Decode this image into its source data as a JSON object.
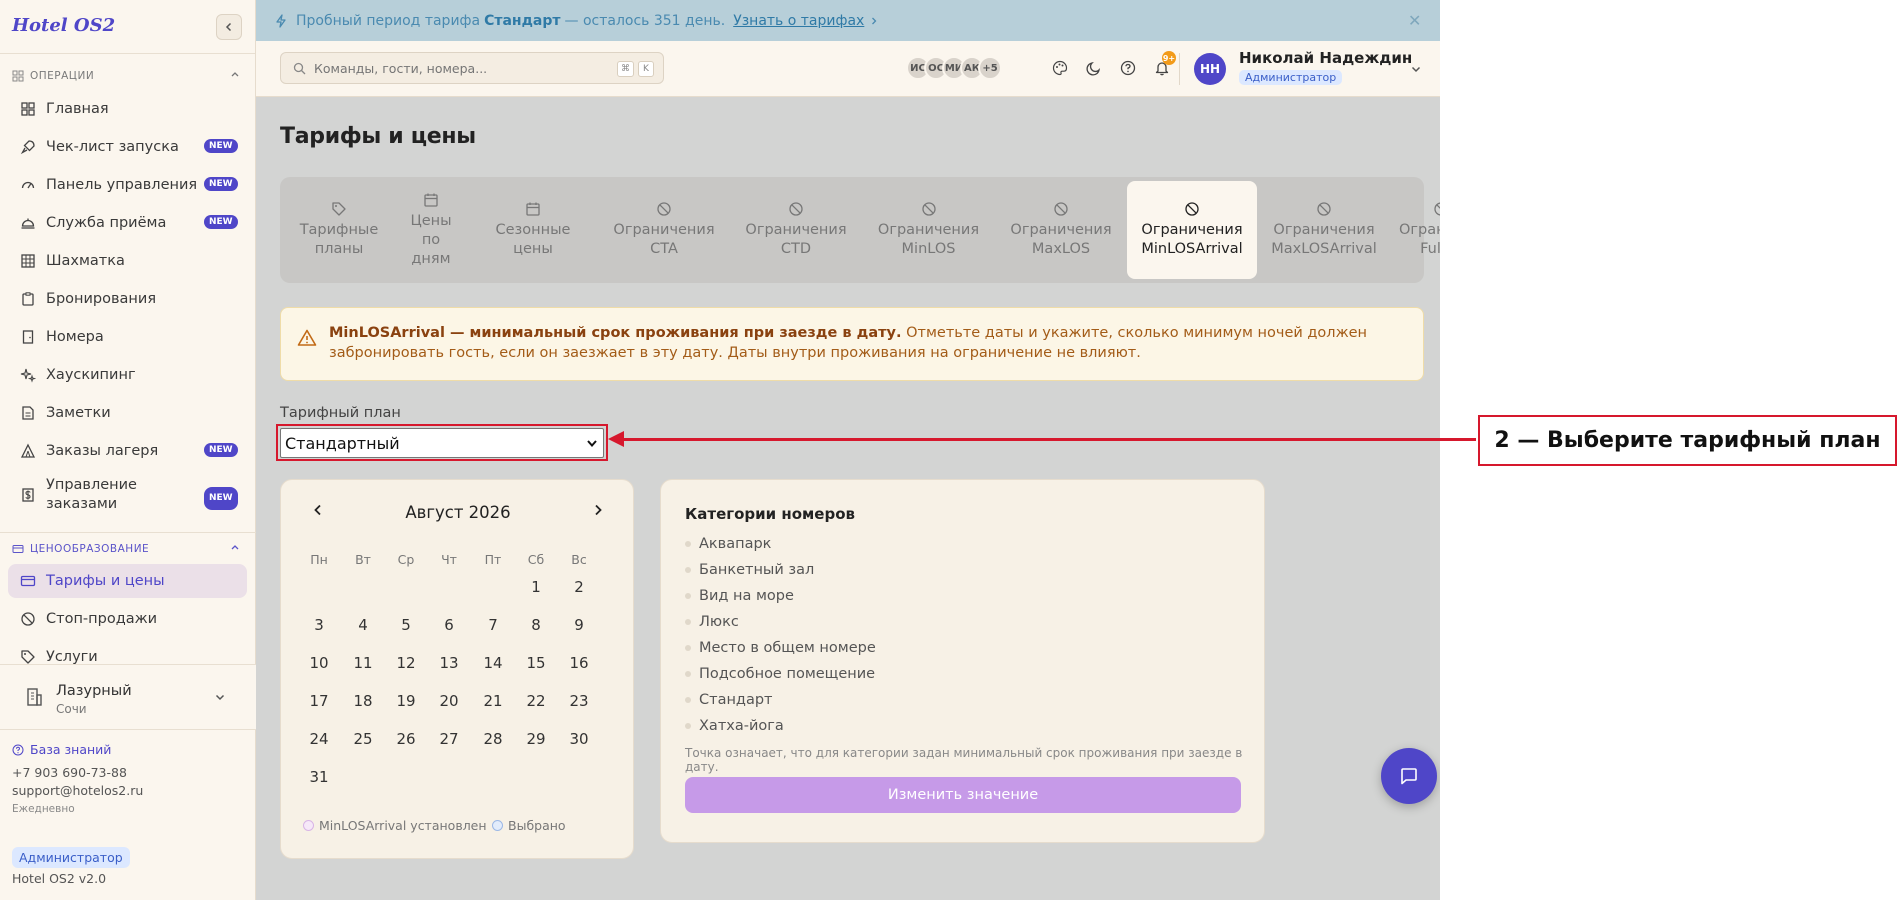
{
  "app": {
    "logo": "Hotel OS2",
    "version": "Hotel OS2 v2.0"
  },
  "sidebar": {
    "sections": [
      {
        "title": "ОПЕРАЦИИ",
        "items": [
          {
            "label": "Главная",
            "icon": "grid-icon",
            "badge": ""
          },
          {
            "label": "Чек-лист запуска",
            "icon": "rocket-icon",
            "badge": "NEW"
          },
          {
            "label": "Панель управления",
            "icon": "gauge-icon",
            "badge": "NEW"
          },
          {
            "label": "Служба приёма",
            "icon": "bell-desk-icon",
            "badge": "NEW"
          },
          {
            "label": "Шахматка",
            "icon": "table-grid-icon",
            "badge": ""
          },
          {
            "label": "Бронирования",
            "icon": "clipboard-icon",
            "badge": ""
          },
          {
            "label": "Номера",
            "icon": "door-icon",
            "badge": ""
          },
          {
            "label": "Хаускипинг",
            "icon": "sparkles-icon",
            "badge": ""
          },
          {
            "label": "Заметки",
            "icon": "note-icon",
            "badge": ""
          },
          {
            "label": "Заказы лагеря",
            "icon": "tent-icon",
            "badge": "NEW"
          },
          {
            "label": "Управление заказами",
            "icon": "dollar-receipt-icon",
            "badge": "NEW"
          }
        ]
      },
      {
        "title": "ЦЕНООБРАЗОВАНИЕ",
        "items": [
          {
            "label": "Тарифы и цены",
            "icon": "credit-card-icon",
            "badge": "",
            "active": true
          },
          {
            "label": "Стоп-продажи",
            "icon": "ban-icon",
            "badge": ""
          },
          {
            "label": "Услуги",
            "icon": "tag-icon",
            "badge": ""
          }
        ]
      }
    ],
    "property": {
      "name": "Лазурный",
      "city": "Сочи"
    },
    "support": {
      "kb_label": "База знаний",
      "phone": "+7 903 690-73-88",
      "email": "support@hotelos2.ru",
      "hours": "Ежедневно"
    },
    "role_badge": "Администратор"
  },
  "banner": {
    "prefix": "Пробный период тарифа",
    "plan": "Стандарт",
    "suffix": "— осталось 351 день.",
    "link": "Узнать о тарифах"
  },
  "topbar": {
    "search_placeholder": "Команды, гости, номера...",
    "kbd": [
      "⌘",
      "K"
    ],
    "avatars": [
      "ИС",
      "ОС",
      "МИ",
      "АК",
      "+5"
    ],
    "notifications_badge": "9+",
    "user": {
      "initials": "НН",
      "name": "Николай Надеждин",
      "role": "Администратор"
    }
  },
  "page": {
    "title": "Тарифы и цены",
    "tabs": [
      {
        "label": "Тарифные планы",
        "icon": "tag-icon"
      },
      {
        "label": "Цены по дням",
        "icon": "calendar-icon"
      },
      {
        "label": "Сезонные цены",
        "icon": "calendar-icon"
      },
      {
        "label": "Ограничения CTA",
        "icon": "ban-icon"
      },
      {
        "label": "Ограничения CTD",
        "icon": "ban-icon"
      },
      {
        "label": "Ограничения MinLOS",
        "icon": "ban-icon"
      },
      {
        "label": "Ограничения MaxLOS",
        "icon": "ban-icon"
      },
      {
        "label": "Ограничения MinLOSArrival",
        "icon": "ban-icon",
        "active": true
      },
      {
        "label": "Ограничения MaxLOSArrival",
        "icon": "ban-icon"
      },
      {
        "label": "Ограничения FullPa",
        "icon": "ban-icon"
      }
    ],
    "alert": {
      "bold": "MinLOSArrival — минимальный срок проживания при заезде в дату.",
      "text": "Отметьте даты и укажите, сколько минимум ночей должен забронировать гость, если он заезжает в эту дату. Даты внутри проживания на ограничение не влияют."
    },
    "plan_label": "Тарифный план",
    "plan_selected": "Стандартный",
    "calendar": {
      "title": "Август 2026",
      "weekdays": [
        "Пн",
        "Вт",
        "Ср",
        "Чт",
        "Пт",
        "Сб",
        "Вс"
      ],
      "first_weekday_index": 5,
      "days_in_month": 31,
      "legend": [
        "MinLOSArrival установлен",
        "Выбрано"
      ]
    },
    "categories": {
      "title": "Категории номеров",
      "items": [
        "Аквапарк",
        "Банкетный зал",
        "Вид на море",
        "Люкс",
        "Место в общем номере",
        "Подсобное помещение",
        "Стандарт",
        "Хатха-йога"
      ],
      "note": "Точка означает, что для категории задан минимальный срок проживания при заезде в дату.",
      "button": "Изменить значение"
    }
  },
  "annotation": {
    "text": "2 — Выберите тарифный план"
  },
  "colors": {
    "accent": "#4f46c8",
    "annotation_red": "#d6182d",
    "button_disabled": "#c69ae8",
    "alert_text": "#a35c18"
  }
}
